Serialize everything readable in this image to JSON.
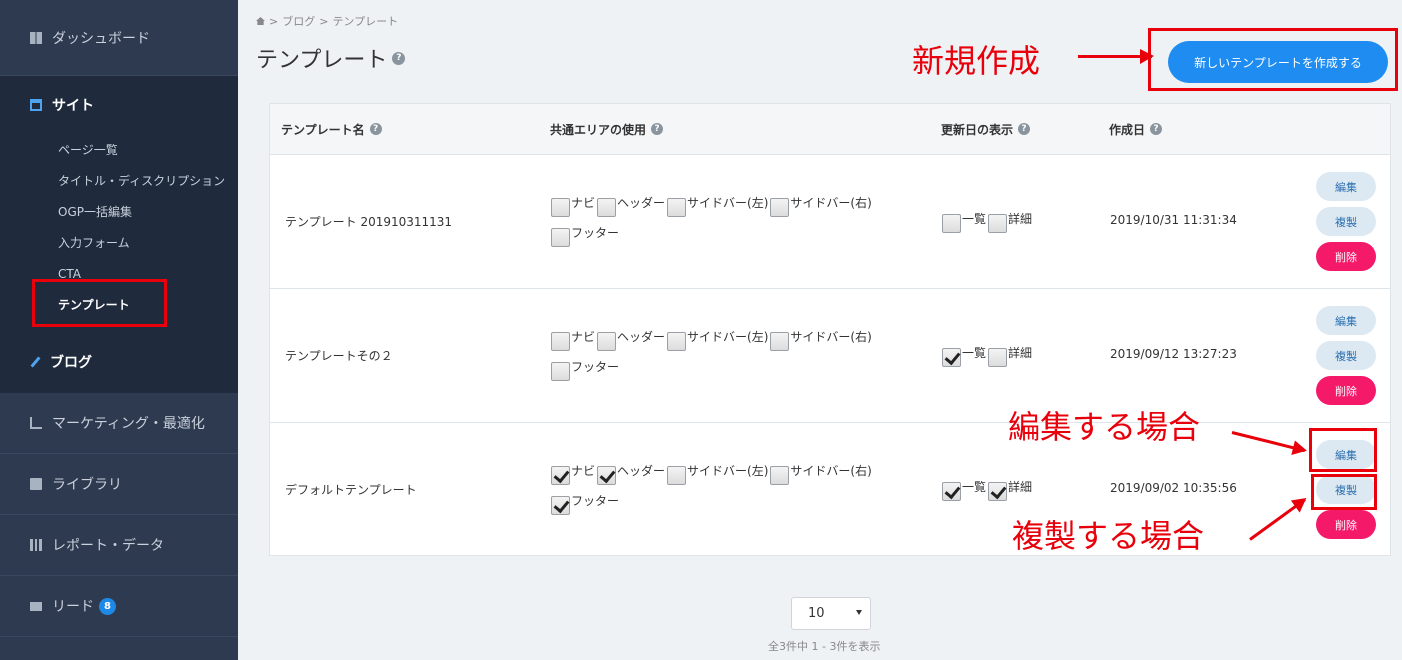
{
  "sidebar": {
    "dashboard": "ダッシュボード",
    "site": "サイト",
    "site_items": [
      "ページ一覧",
      "タイトル・ディスクリプション",
      "OGP一括編集",
      "入力フォーム",
      "CTA",
      "テンプレート"
    ],
    "blog": "ブログ",
    "marketing": "マーケティング・最適化",
    "library": "ライブラリ",
    "report": "レポート・データ",
    "lead": "リード",
    "lead_badge": "8"
  },
  "breadcrumb": [
    "ブログ",
    "テンプレート"
  ],
  "breadcrumb_sep": ">",
  "page_title": "テンプレート",
  "create_button": "新しいテンプレートを作成する",
  "table": {
    "headers": {
      "name": "テンプレート名",
      "areas": "共通エリアの使用",
      "update_display": "更新日の表示",
      "created": "作成日"
    },
    "area_labels": [
      "ナビ",
      "ヘッダー",
      "サイドバー(左)",
      "サイドバー(右)",
      "フッター"
    ],
    "update_labels": [
      "一覧",
      "詳細"
    ],
    "rows": [
      {
        "name": "テンプレート 201910311131",
        "areas": [
          false,
          false,
          false,
          false,
          false
        ],
        "updates": [
          false,
          false
        ],
        "created": "2019/10/31 11:31:34"
      },
      {
        "name": "テンプレートその２",
        "areas": [
          false,
          false,
          false,
          false,
          false
        ],
        "updates": [
          true,
          false
        ],
        "created": "2019/09/12 13:27:23"
      },
      {
        "name": "デフォルトテンプレート",
        "areas": [
          true,
          true,
          false,
          false,
          true
        ],
        "updates": [
          true,
          true
        ],
        "created": "2019/09/02 10:35:56"
      }
    ],
    "actions": {
      "edit": "編集",
      "copy": "複製",
      "delete": "削除"
    }
  },
  "pager": {
    "per_page": "10",
    "summary": "全3件中 1 - 3件を表示"
  },
  "annotations": {
    "create": "新規作成",
    "edit": "編集する場合",
    "copy": "複製する場合"
  },
  "colors": {
    "sidebar_bg": "#2e3a4f",
    "primary": "#1e8cf0",
    "danger": "#f5196a",
    "annotation": "#e8000b"
  }
}
